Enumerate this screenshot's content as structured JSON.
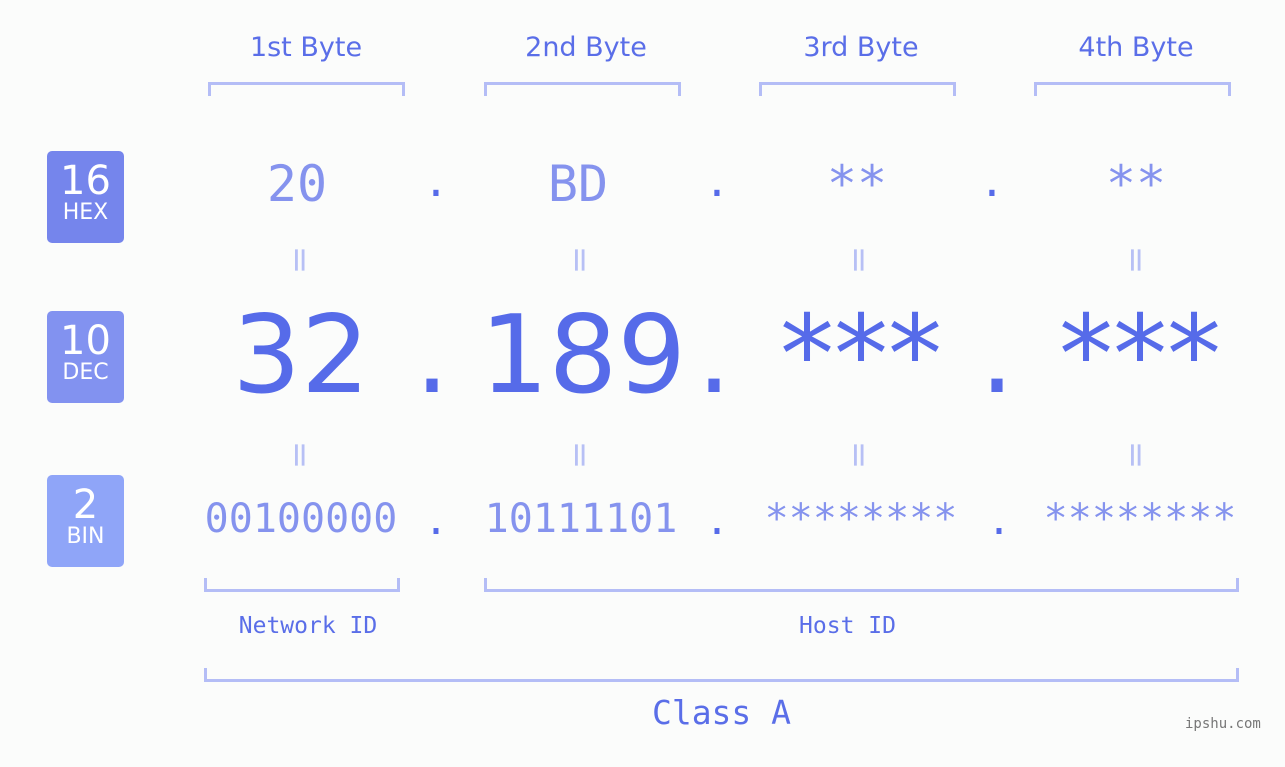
{
  "bytes": [
    {
      "label": "1st Byte",
      "hex": "20",
      "dec": "32",
      "bin": "00100000"
    },
    {
      "label": "2nd Byte",
      "hex": "BD",
      "dec": "189",
      "bin": "10111101"
    },
    {
      "label": "3rd Byte",
      "hex": "**",
      "dec": "***",
      "bin": "********"
    },
    {
      "label": "4th Byte",
      "hex": "**",
      "dec": "***",
      "bin": "********"
    }
  ],
  "badges": {
    "hex": {
      "num": "16",
      "label": "HEX",
      "color": "#7585ec"
    },
    "dec": {
      "num": "10",
      "label": "DEC",
      "color": "#8292f0"
    },
    "bin": {
      "num": "2",
      "label": "BIN",
      "color": "#8fa5f8"
    }
  },
  "separator": ".",
  "equals": "=",
  "parts": {
    "network": "Network ID",
    "host": "Host ID",
    "class": "Class A"
  },
  "watermark": "ipshu.com",
  "colors": {
    "accent": "#566be9",
    "light": "#8593ee",
    "bracket": "#b4bdf6"
  }
}
